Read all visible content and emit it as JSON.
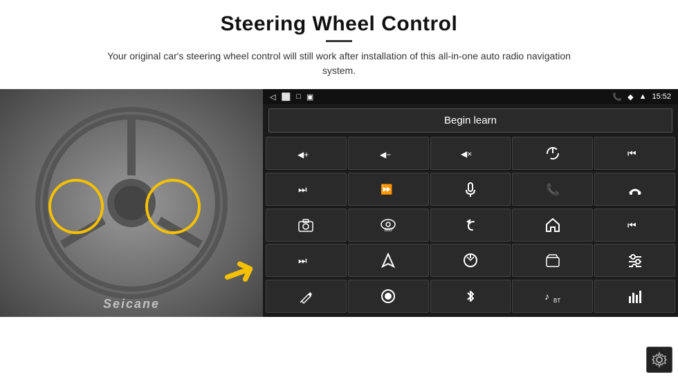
{
  "header": {
    "title": "Steering Wheel Control",
    "subtitle": "Your original car's steering wheel control will still work after installation of this all-in-one auto radio navigation system."
  },
  "statusBar": {
    "time": "15:52",
    "leftIcons": [
      "◁",
      "⬜",
      "□"
    ],
    "rightIcons": [
      "📞",
      "◆",
      "▲"
    ]
  },
  "beginLearnButton": {
    "label": "Begin learn"
  },
  "controlGrid": {
    "buttons": [
      {
        "icon": "🔊+",
        "symbol": "vol_up"
      },
      {
        "icon": "🔊−",
        "symbol": "vol_down"
      },
      {
        "icon": "🔇",
        "symbol": "mute"
      },
      {
        "icon": "⏻",
        "symbol": "power"
      },
      {
        "icon": "⏮",
        "symbol": "prev_track"
      },
      {
        "icon": "⏭",
        "symbol": "next"
      },
      {
        "icon": "⏭⏮",
        "symbol": "ff_rw"
      },
      {
        "icon": "🎤",
        "symbol": "mic"
      },
      {
        "icon": "📞",
        "symbol": "phone"
      },
      {
        "icon": "↩",
        "symbol": "hangup"
      },
      {
        "icon": "📷",
        "symbol": "camera"
      },
      {
        "icon": "👁360",
        "symbol": "cam360"
      },
      {
        "icon": "↶",
        "symbol": "back"
      },
      {
        "icon": "🏠",
        "symbol": "home"
      },
      {
        "icon": "⏮⏮",
        "symbol": "rewind"
      },
      {
        "icon": "⏭⏭",
        "symbol": "ff"
      },
      {
        "icon": "▶",
        "symbol": "nav"
      },
      {
        "icon": "⇄",
        "symbol": "switch"
      },
      {
        "icon": "📻",
        "symbol": "radio"
      },
      {
        "icon": "⚙",
        "symbol": "settings"
      },
      {
        "icon": "✏",
        "symbol": "edit"
      },
      {
        "icon": "⏺",
        "symbol": "record"
      },
      {
        "icon": "🔵",
        "symbol": "bt"
      },
      {
        "icon": "♪",
        "symbol": "music"
      },
      {
        "icon": "📊",
        "symbol": "equalizer"
      }
    ]
  },
  "seicane": {
    "watermark": "Seicane"
  },
  "gear": {
    "label": "Settings"
  }
}
